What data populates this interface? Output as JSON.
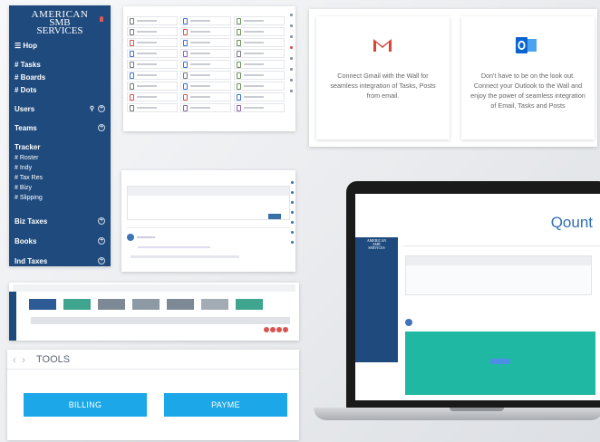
{
  "sidebar": {
    "logo": [
      "AMERICAN",
      "SMB",
      "SERVICES"
    ],
    "hop": "Hop",
    "links": [
      "# Tasks",
      "# Boards",
      "# Dots"
    ],
    "sections": [
      {
        "label": "Users"
      },
      {
        "label": "Teams"
      }
    ],
    "tracker": {
      "label": "Tracker",
      "items": [
        "# Roster",
        "# Indy",
        "# Tax Res",
        "# Bizy",
        "# Slipping"
      ]
    },
    "bottom": [
      "Biz Taxes",
      "Books",
      "Ind Taxes"
    ]
  },
  "integrations": {
    "gmail_text": "Connect Gmail with the Wall for seamless integration of Tasks, Posts from email.",
    "outlook_text": "Don't have to be on the look out. Connect your Outlook to the Wall and enjoy the power of seamless integration of Email, Tasks and Posts",
    "gmail_color": "#d44638",
    "outlook_color": "#0a64d0"
  },
  "laptop": {
    "brand": "Qount"
  },
  "tools": {
    "title": "TOOLS",
    "buttons": [
      "BILLING",
      "PAYME"
    ],
    "button_color": "#1ca8e8"
  },
  "colors": {
    "navy": "#1f4a7d",
    "teal": "#1fb8a2"
  }
}
